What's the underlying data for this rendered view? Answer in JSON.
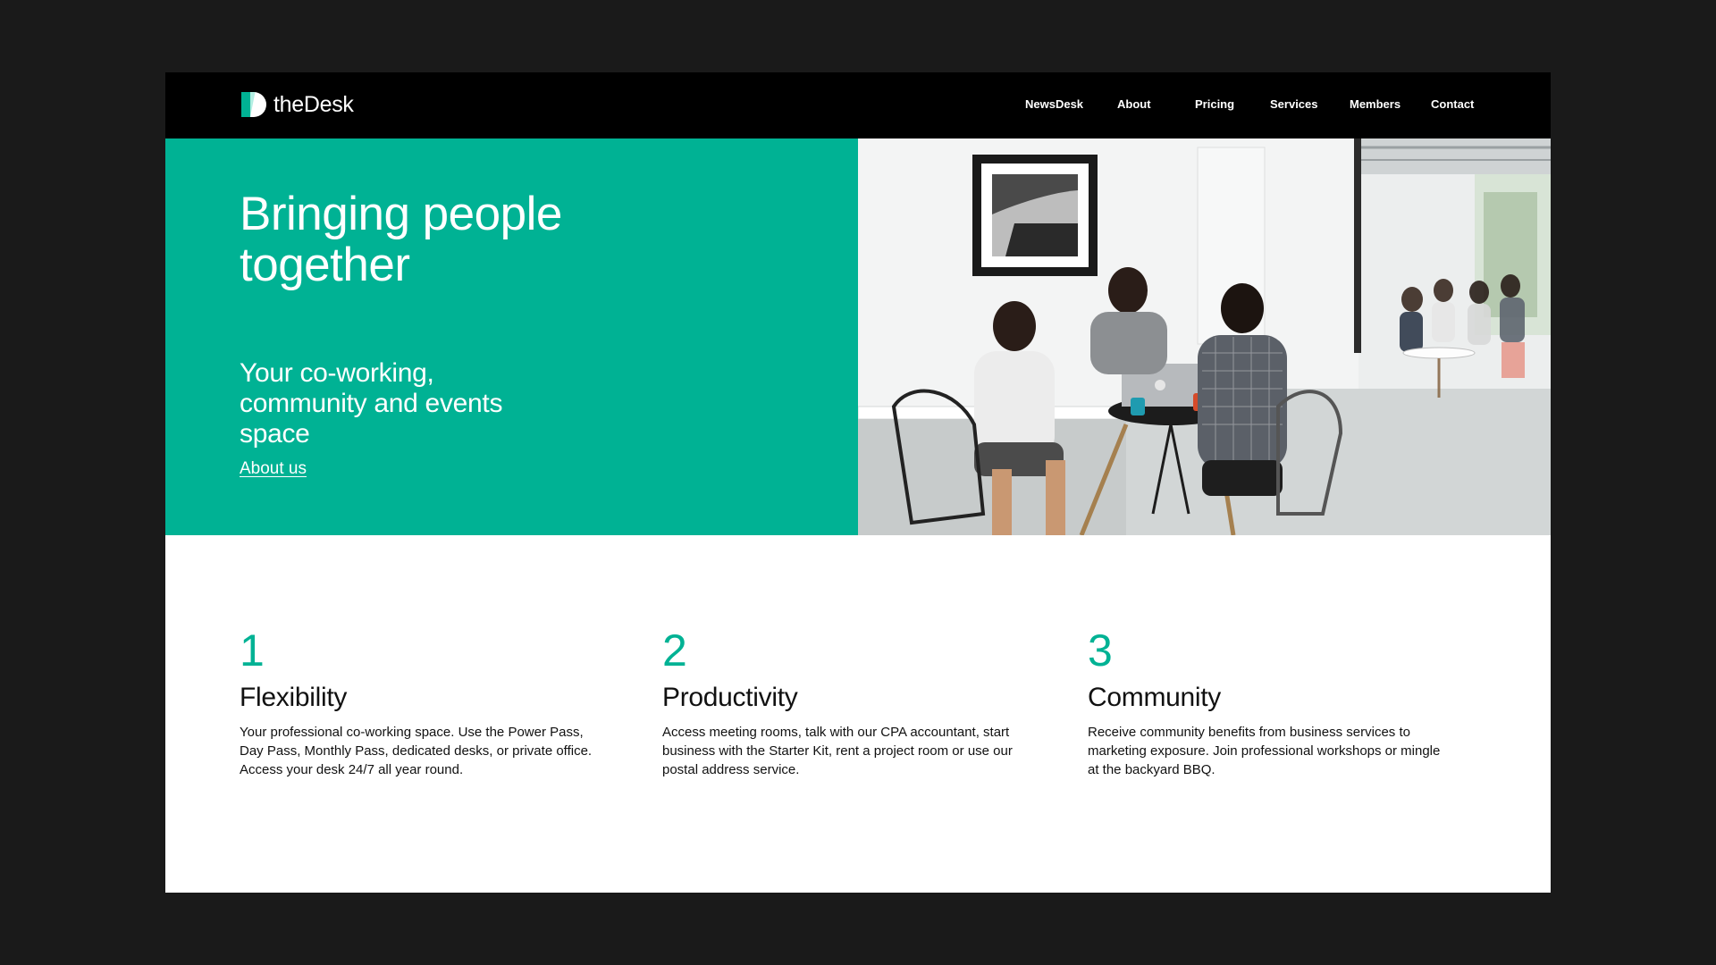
{
  "brand": {
    "name": "theDesk",
    "accent_color": "#00b294",
    "logo_icon": "half-circle-d-logo-icon"
  },
  "nav": {
    "items": [
      {
        "label": "NewsDesk"
      },
      {
        "label": "About"
      },
      {
        "label": "Pricing"
      },
      {
        "label": "Services"
      },
      {
        "label": "Members"
      },
      {
        "label": "Contact"
      }
    ]
  },
  "hero": {
    "title": "Bringing people together",
    "subtitle": "Your co-working, community and events space",
    "link_label": "About us",
    "image_alt": "coworking-photo"
  },
  "features": [
    {
      "number": "1",
      "title": "Flexibility",
      "text": "Your professional co-working space. Use the Power Pass, Day Pass, Monthly Pass, dedicated desks, or private office. Access your desk 24/7 all year round."
    },
    {
      "number": "2",
      "title": "Productivity",
      "text": "Access meeting rooms, talk with our CPA accountant, start business with the Starter Kit, rent a project room or use our postal address service."
    },
    {
      "number": "3",
      "title": "Community",
      "text": "Receive community benefits from business services to marketing exposure. Join professional workshops or mingle at the backyard BBQ."
    }
  ]
}
